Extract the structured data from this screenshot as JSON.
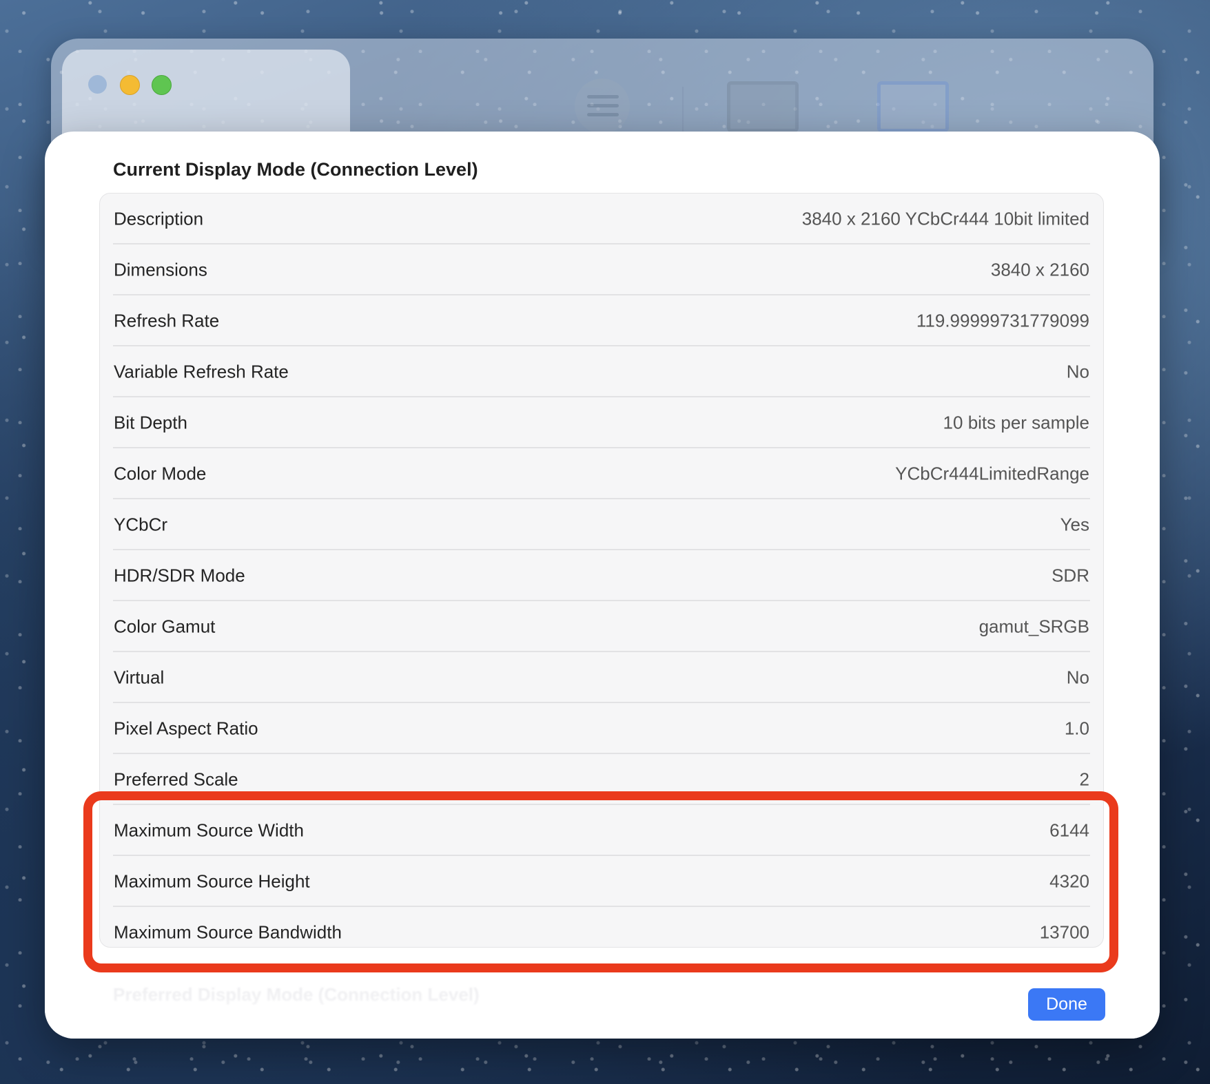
{
  "window": {
    "traffic_lights": [
      "close",
      "minimize",
      "zoom"
    ],
    "toolbar_icons": [
      "list-icon",
      "display-icon",
      "display-selected-icon"
    ]
  },
  "sheet": {
    "section_title": "Current Display Mode (Connection Level)",
    "rows": [
      {
        "label": "Description",
        "value": "3840 x 2160 YCbCr444 10bit limited"
      },
      {
        "label": "Dimensions",
        "value": "3840 x 2160"
      },
      {
        "label": "Refresh Rate",
        "value": "119.99999731779099"
      },
      {
        "label": "Variable Refresh Rate",
        "value": "No"
      },
      {
        "label": "Bit Depth",
        "value": "10 bits per sample"
      },
      {
        "label": "Color Mode",
        "value": "YCbCr444LimitedRange"
      },
      {
        "label": "YCbCr",
        "value": "Yes"
      },
      {
        "label": "HDR/SDR Mode",
        "value": "SDR"
      },
      {
        "label": "Color Gamut",
        "value": "gamut_SRGB"
      },
      {
        "label": "Virtual",
        "value": "No"
      },
      {
        "label": "Pixel Aspect Ratio",
        "value": "1.0"
      },
      {
        "label": "Preferred Scale",
        "value": "2"
      },
      {
        "label": "Maximum Source Width",
        "value": "6144"
      },
      {
        "label": "Maximum Source Height",
        "value": "4320"
      },
      {
        "label": "Maximum Source Bandwidth",
        "value": "13700"
      }
    ],
    "next_section_title": "Preferred Display Mode (Connection Level)",
    "done_label": "Done"
  },
  "colors": {
    "accent": "#3b78f5",
    "highlight": "#ea3a1c"
  }
}
